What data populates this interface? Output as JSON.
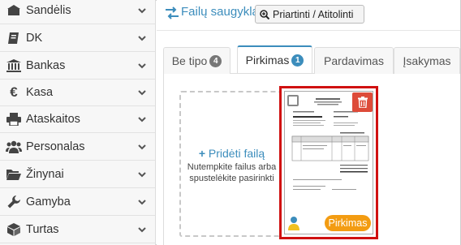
{
  "sidebar": {
    "items": [
      {
        "label": "Sandėlis",
        "icon": "warehouse-icon"
      },
      {
        "label": "DK",
        "icon": "book-icon"
      },
      {
        "label": "Bankas",
        "icon": "bank-icon"
      },
      {
        "label": "Kasa",
        "icon": "euro-icon"
      },
      {
        "label": "Ataskaitos",
        "icon": "printer-icon"
      },
      {
        "label": "Personalas",
        "icon": "users-icon"
      },
      {
        "label": "Žinynai",
        "icon": "folder-open-icon"
      },
      {
        "label": "Gamyba",
        "icon": "wrench-icon"
      },
      {
        "label": "Turtas",
        "icon": "cube-icon"
      }
    ]
  },
  "header": {
    "title": "Failų saugykla",
    "zoom_button": "Priartinti / Atitolinti"
  },
  "tabs": [
    {
      "label": "Be tipo",
      "count": "4",
      "active": false
    },
    {
      "label": "Pirkimas",
      "count": "1",
      "active": true
    },
    {
      "label": "Pardavimas",
      "count": "",
      "active": false
    },
    {
      "label": "Įsakymas",
      "count": "",
      "active": false
    }
  ],
  "upload": {
    "add_label": "Pridėti failą",
    "hint": "Nutempkite failus arba spustelėkite pasirinkti"
  },
  "file_card": {
    "type_label": "Pirkimas"
  },
  "colors": {
    "accent": "#3c8dbc",
    "badge_grey": "#777777",
    "danger": "#dd4b39",
    "warning": "#f39c12",
    "selection_border": "#d01010"
  }
}
